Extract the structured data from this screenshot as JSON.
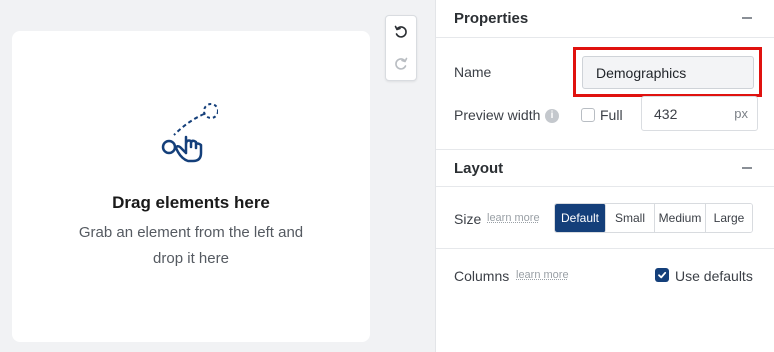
{
  "canvas": {
    "title": "Drag elements here",
    "subtitle_line1": "Grab an element from the left and",
    "subtitle_line2": "drop it here",
    "icon": "drag-gesture-icon"
  },
  "history": {
    "undo_icon": "undo-icon",
    "redo_icon": "redo-icon"
  },
  "properties": {
    "title": "Properties",
    "collapse_icon": "minus-icon",
    "name_label": "Name",
    "name_value": "Demographics",
    "preview_width_label": "Preview width",
    "info_icon": "info-icon",
    "info_glyph": "i",
    "full_label": "Full",
    "full_checked": false,
    "width_value": "432",
    "width_unit": "px"
  },
  "layout": {
    "title": "Layout",
    "collapse_icon": "minus-icon",
    "size_label": "Size",
    "size_learn_more": "learn more",
    "size_options": [
      "Default",
      "Small",
      "Medium",
      "Large"
    ],
    "size_selected": "Default",
    "columns_label": "Columns",
    "columns_learn_more": "learn more",
    "use_defaults_label": "Use defaults",
    "use_defaults_checked": true
  },
  "colors": {
    "accent": "#143f7a",
    "highlight_border": "#e0120f"
  }
}
